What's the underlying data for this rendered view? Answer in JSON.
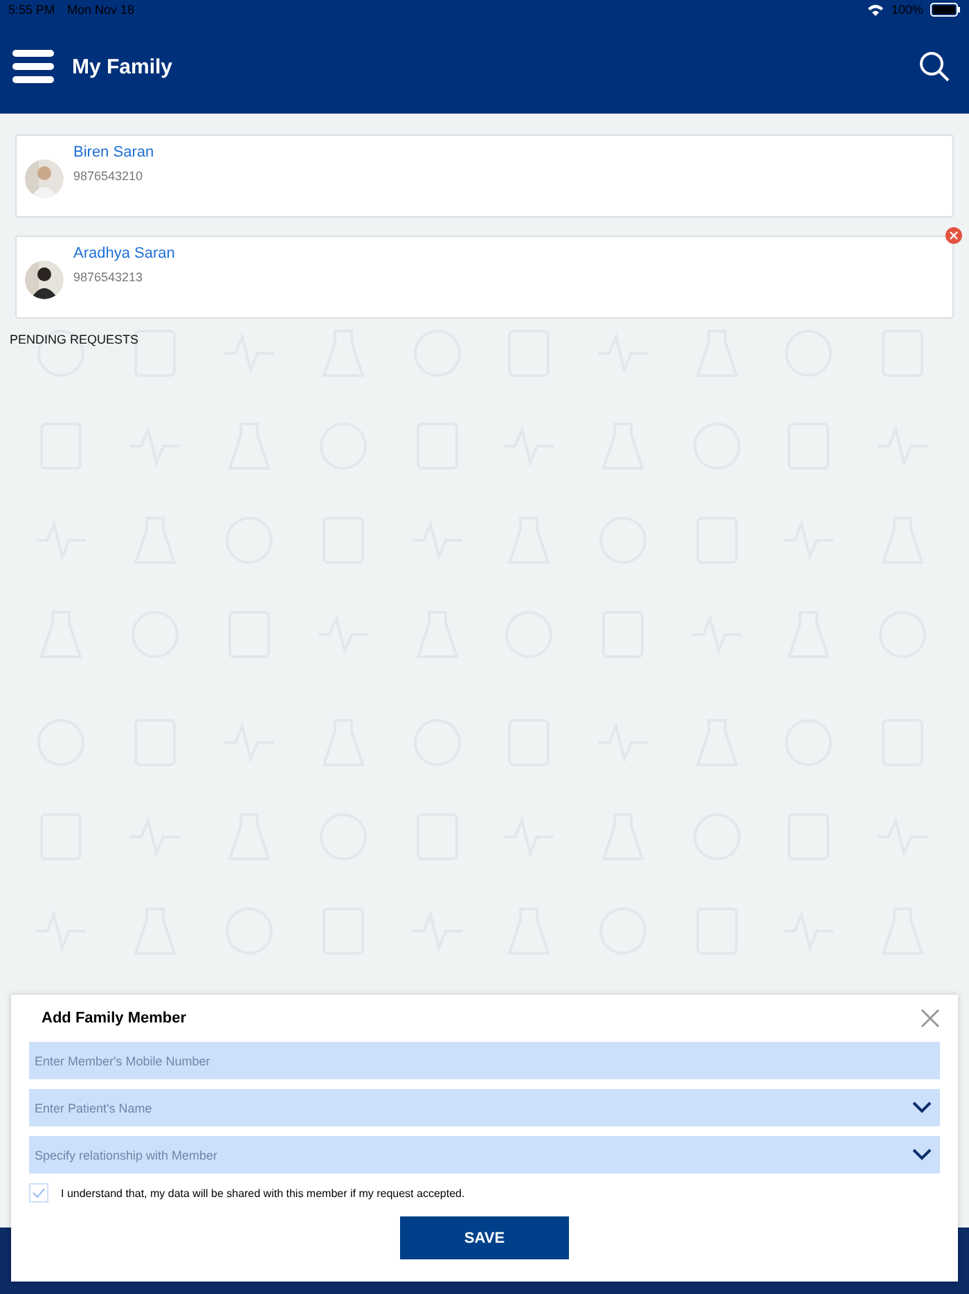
{
  "status_bar": {
    "time": "5:55 PM",
    "date": "Mon Nov 18",
    "battery": "100%"
  },
  "header": {
    "title": "My Family"
  },
  "members": [
    {
      "name": "Biren Saran",
      "phone": "9876543210",
      "removable": false
    },
    {
      "name": "Aradhya Saran",
      "phone": "9876543213",
      "removable": true
    }
  ],
  "pending_requests": {
    "heading": "PENDING REQUESTS"
  },
  "dialog": {
    "title": "Add Family Member",
    "fields": [
      {
        "kind": "text",
        "placeholder": "Enter Member's Mobile Number"
      },
      {
        "kind": "dropdown",
        "placeholder": "Enter Patient's Name"
      },
      {
        "kind": "dropdown",
        "placeholder": "Specify relationship with Member"
      }
    ],
    "consent": {
      "checked": true,
      "label": "I understand that, my data will be shared with this member if my request accepted."
    },
    "save_button": "SAVE"
  }
}
